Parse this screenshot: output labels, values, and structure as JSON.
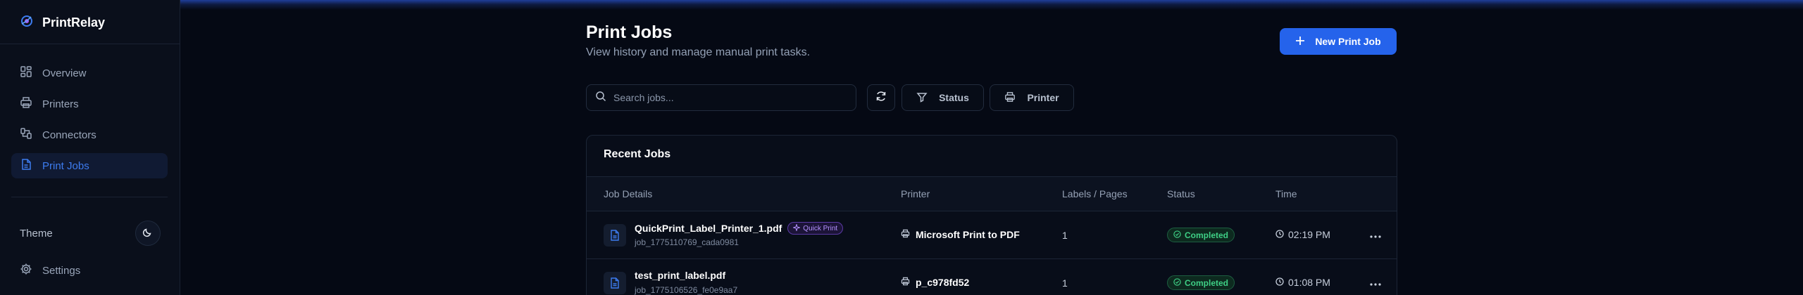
{
  "app": {
    "name": "PrintRelay"
  },
  "sidebar": {
    "items": [
      {
        "label": "Overview",
        "icon": "grid-icon"
      },
      {
        "label": "Printers",
        "icon": "printer-icon"
      },
      {
        "label": "Connectors",
        "icon": "connector-icon"
      },
      {
        "label": "Print Jobs",
        "icon": "file-icon",
        "active": true
      }
    ],
    "theme_label": "Theme",
    "settings_label": "Settings"
  },
  "header": {
    "title": "Print Jobs",
    "subtitle": "View history and manage manual print tasks.",
    "new_button_label": "New Print Job"
  },
  "toolbar": {
    "search_placeholder": "Search jobs...",
    "status_filter_label": "Status",
    "printer_filter_label": "Printer"
  },
  "table": {
    "title": "Recent Jobs",
    "columns": [
      "Job Details",
      "Printer",
      "Labels / Pages",
      "Status",
      "Time"
    ],
    "rows": [
      {
        "file_name": "QuickPrint_Label_Printer_1.pdf",
        "badge": "Quick Print",
        "job_id": "job_1775110769_cada0981",
        "printer": "Microsoft Print to PDF",
        "labels": "1",
        "status": "Completed",
        "time": "02:19 PM"
      },
      {
        "file_name": "test_print_label.pdf",
        "job_id": "job_1775106526_fe0e9aa7",
        "printer": "p_c978fd52",
        "labels": "1",
        "status": "Completed",
        "time": "01:08 PM"
      }
    ]
  },
  "colors": {
    "accent": "#2563eb",
    "active_nav_text": "#3d7cf0",
    "status_completed": "#3ecf85",
    "quick_print_badge": "#b592ff",
    "background": "#050914"
  }
}
